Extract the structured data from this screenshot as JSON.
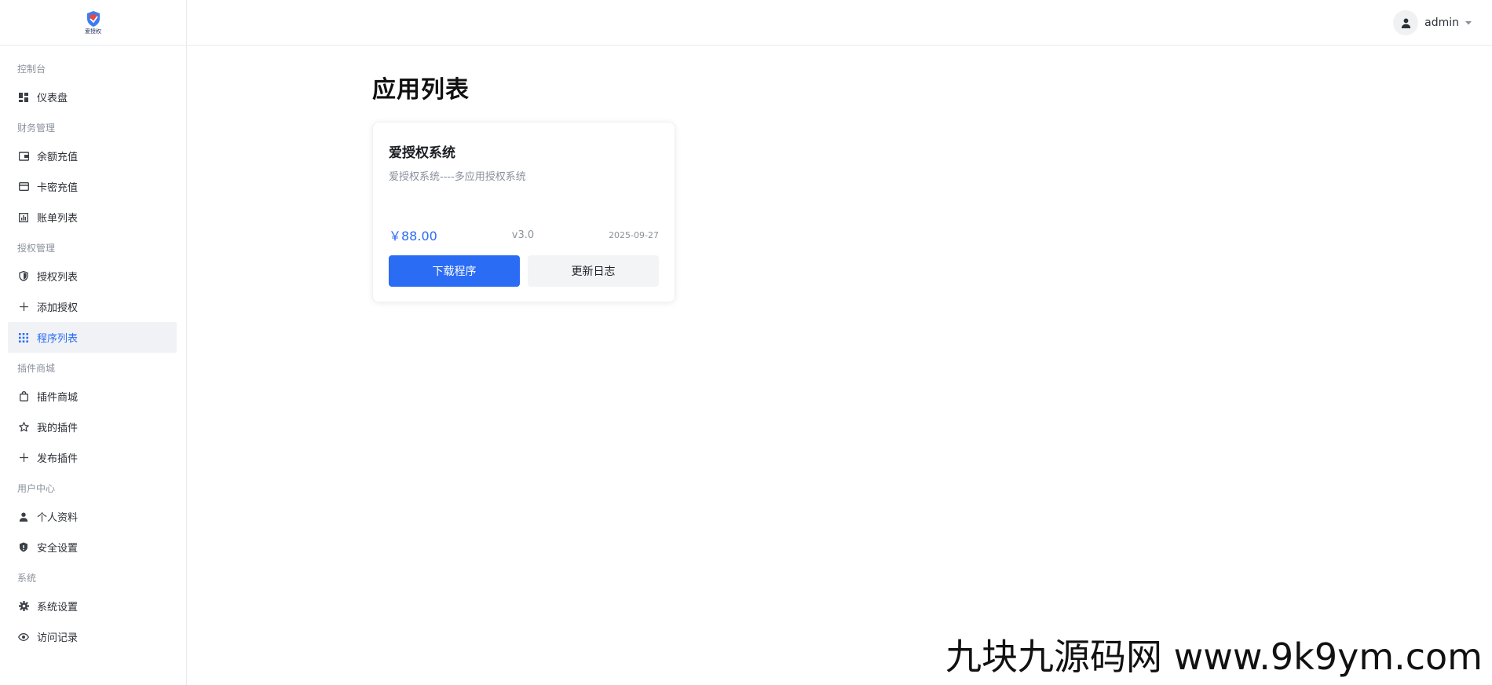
{
  "logo": {
    "text": "爱授权"
  },
  "header": {
    "username": "admin"
  },
  "sidebar": {
    "sections": [
      {
        "title": "控制台",
        "items": [
          {
            "label": "仪表盘",
            "icon": "dashboard-icon"
          }
        ]
      },
      {
        "title": "财务管理",
        "items": [
          {
            "label": "余额充值",
            "icon": "wallet-icon"
          },
          {
            "label": "卡密充值",
            "icon": "credit-card-icon"
          },
          {
            "label": "账单列表",
            "icon": "bar-chart-icon"
          }
        ]
      },
      {
        "title": "授权管理",
        "items": [
          {
            "label": "授权列表",
            "icon": "shield-icon"
          },
          {
            "label": "添加授权",
            "icon": "plus-icon"
          },
          {
            "label": "程序列表",
            "icon": "grid-icon",
            "active": true
          }
        ]
      },
      {
        "title": "插件商城",
        "items": [
          {
            "label": "插件商城",
            "icon": "shopping-bag-icon"
          },
          {
            "label": "我的插件",
            "icon": "star-icon"
          },
          {
            "label": "发布插件",
            "icon": "plus-icon"
          }
        ]
      },
      {
        "title": "用户中心",
        "items": [
          {
            "label": "个人资料",
            "icon": "user-icon"
          },
          {
            "label": "安全设置",
            "icon": "shield-check-icon"
          }
        ]
      },
      {
        "title": "系统",
        "items": [
          {
            "label": "系统设置",
            "icon": "gear-icon"
          },
          {
            "label": "访问记录",
            "icon": "eye-icon"
          }
        ]
      }
    ]
  },
  "main": {
    "title": "应用列表",
    "apps": [
      {
        "name": "爱授权系统",
        "description": "爱授权系统----多应用授权系统",
        "price": "￥88.00",
        "version": "v3.0",
        "date": "2025-09-27",
        "download_label": "下载程序",
        "changelog_label": "更新日志"
      }
    ]
  },
  "watermark": "九块九源码网 www.9k9ym.com",
  "colors": {
    "accent": "#2b6cf5",
    "active_bg": "#f0f2f5",
    "muted": "#8a919c"
  }
}
